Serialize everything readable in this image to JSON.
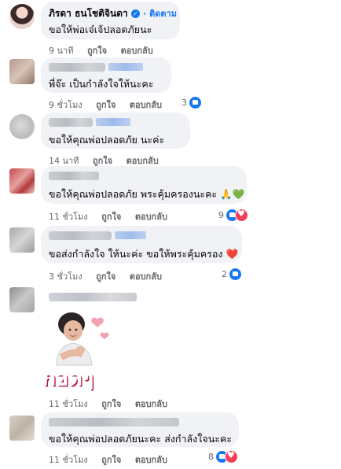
{
  "comments": [
    {
      "author": "ภิรดา ธนโชติจินดา",
      "verified_icon": "verified-badge-icon",
      "follow_label": "· ติดตาม",
      "text": "ขอให้พ่อเจ๋เจ้ปลอดภัยนะ",
      "time": "9 นาที",
      "like_label": "ถูกใจ",
      "reply_label": "ตอบกลับ"
    },
    {
      "author_blurred": true,
      "text": "พี่จ๊ะ เป็นกำลังใจให้นะคะ",
      "time": "9 ชั่วโมง",
      "like_label": "ถูกใจ",
      "reply_label": "ตอบกลับ",
      "reaction_count": "3"
    },
    {
      "author_blurred": true,
      "text": "ขอให้คุณพ่อปลอดภัย นะค่ะ",
      "time": "14 นาที",
      "like_label": "ถูกใจ",
      "reply_label": "ตอบกลับ"
    },
    {
      "author_blurred": true,
      "text": "ขอให้คุณพ่อปลอดภัย พระคุ้มครองนะคะ",
      "text_emoji": "🙏💚",
      "time": "11 ชั่วโมง",
      "like_label": "ถูกใจ",
      "reply_label": "ตอบกลับ",
      "reaction_count": "9"
    },
    {
      "author_blurred": true,
      "text": "ขอส่งกำลังใจ ให้นะค่ะ ขอให้พระคุ้มครอง",
      "text_emoji": "❤️",
      "time": "3 ชั่วโมง",
      "like_label": "ถูกใจ",
      "reply_label": "ตอบกลับ",
      "reaction_count": "2"
    },
    {
      "author_blurred": true,
      "sticker_text": "กอดๆ",
      "time": "11 ชั่วโมง",
      "like_label": "ถูกใจ",
      "reply_label": "ตอบกลับ"
    },
    {
      "author_blurred": true,
      "text": "ขอให้คุณพ่อปลอดภัยนะคะ ส่งกำลังใจนะคะ",
      "time": "11 ชั่วโมง",
      "like_label": "ถูกใจ",
      "reply_label": "ตอบกลับ",
      "reaction_count": "8"
    }
  ],
  "colors": {
    "bubble": "#f0f2f5",
    "link_blue": "#1877f2",
    "meta_gray": "#65676b",
    "like_blue": "#1877f2",
    "love_red": "#f33e58"
  }
}
